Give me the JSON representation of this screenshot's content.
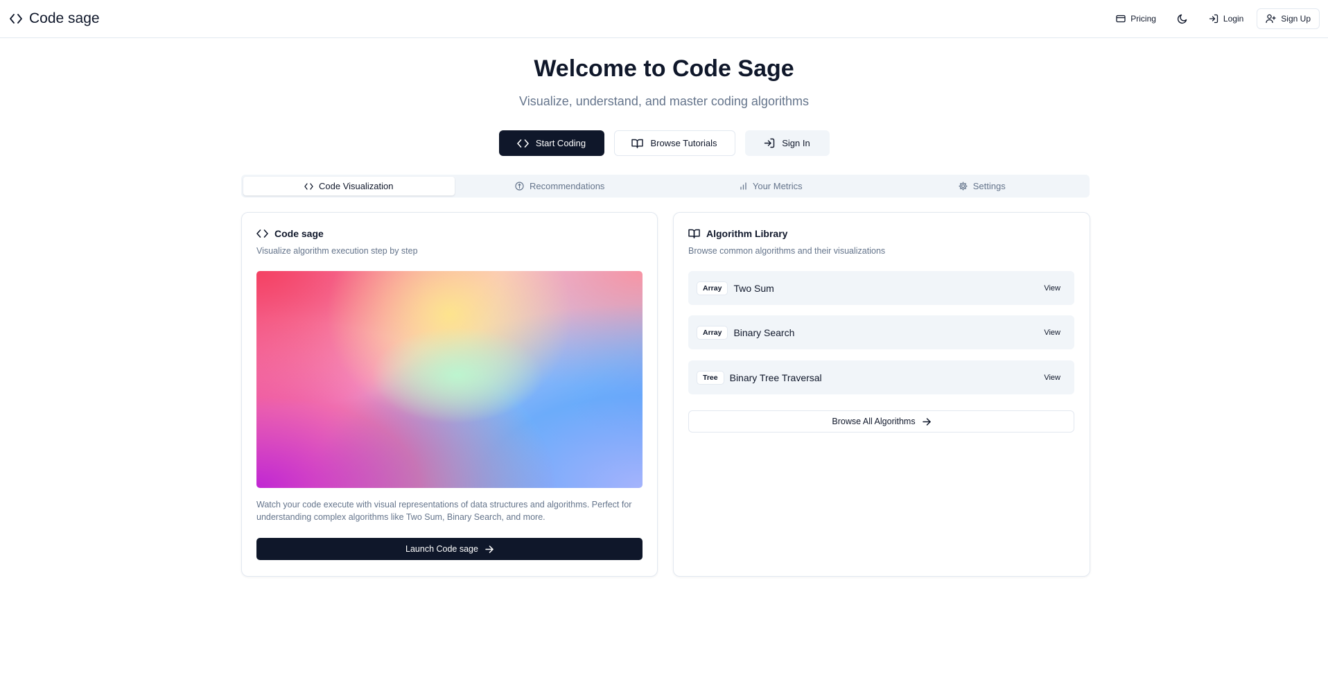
{
  "header": {
    "brand": "Code sage",
    "nav": [
      {
        "label": "Pricing",
        "icon": "credit-card-icon"
      },
      {
        "label": "",
        "icon": "moon-icon"
      },
      {
        "label": "Login",
        "icon": "log-in-icon"
      },
      {
        "label": "Sign Up",
        "icon": "user-plus-icon"
      }
    ]
  },
  "hero": {
    "title": "Welcome to Code Sage",
    "subtitle": "Visualize, understand, and master coding algorithms",
    "actions": {
      "start": "Start Coding",
      "browse": "Browse Tutorials",
      "signin": "Sign In"
    }
  },
  "tabs": [
    {
      "label": "Code Visualization",
      "icon": "code-icon",
      "active": true
    },
    {
      "label": "Recommendations",
      "icon": "compass-icon",
      "active": false
    },
    {
      "label": "Your Metrics",
      "icon": "bar-chart-icon",
      "active": false
    },
    {
      "label": "Settings",
      "icon": "gear-icon",
      "active": false
    }
  ],
  "visualizer_card": {
    "title": "Code sage",
    "description": "Visualize algorithm execution step by step",
    "body": "Watch your code execute with visual representations of data structures and algorithms. Perfect for understanding complex algorithms like Two Sum, Binary Search, and more.",
    "launch_label": "Launch Code sage"
  },
  "library_card": {
    "title": "Algorithm Library",
    "description": "Browse common algorithms and their visualizations",
    "items": [
      {
        "tag": "Array",
        "name": "Two Sum",
        "action": "View"
      },
      {
        "tag": "Array",
        "name": "Binary Search",
        "action": "View"
      },
      {
        "tag": "Tree",
        "name": "Binary Tree Traversal",
        "action": "View"
      }
    ],
    "browse_all_label": "Browse All Algorithms"
  },
  "colors": {
    "primary": "#0f172a",
    "muted": "#64748b",
    "border": "#e2e8f0",
    "surface": "#f1f5f9"
  }
}
